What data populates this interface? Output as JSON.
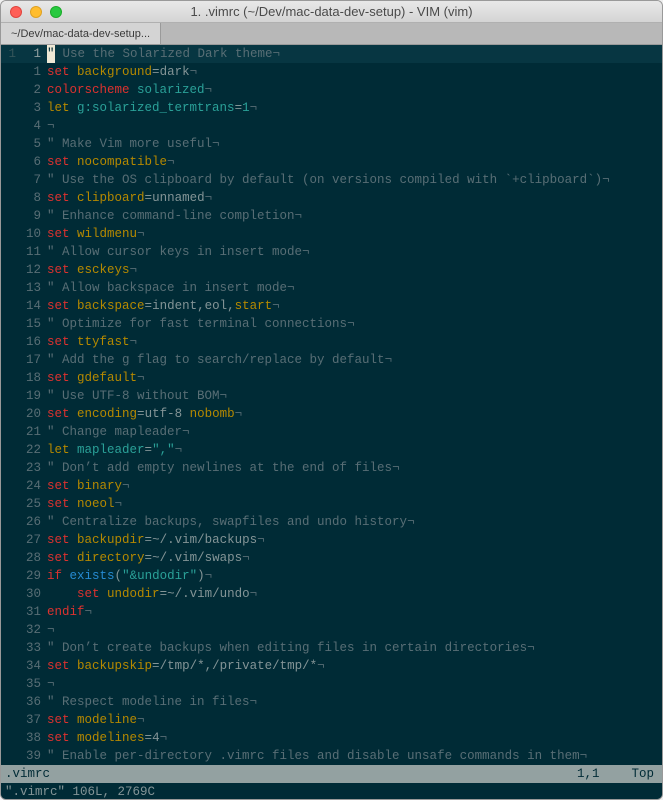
{
  "window": {
    "title": "1. .vimrc (~/Dev/mac-data-dev-setup) - VIM (vim)",
    "tab": "~/Dev/mac-data-dev-setup..."
  },
  "gutter_outer": "1",
  "lines": [
    {
      "n": "1",
      "tokens": [
        {
          "t": "\"",
          "c": "c-comment"
        },
        {
          "t": " Use the Solarized Dark theme",
          "c": "c-comment"
        },
        {
          "t": "¬",
          "c": "c-neg"
        }
      ],
      "cursor": true
    },
    {
      "n": "1",
      "tokens": [
        {
          "t": "set",
          "c": "c-set"
        },
        {
          "t": " "
        },
        {
          "t": "background",
          "c": "c-option"
        },
        {
          "t": "=",
          "c": "c-eq"
        },
        {
          "t": "dark",
          "c": "c-val"
        },
        {
          "t": "¬",
          "c": "c-neg"
        }
      ]
    },
    {
      "n": "2",
      "tokens": [
        {
          "t": "colorscheme",
          "c": "c-set"
        },
        {
          "t": " "
        },
        {
          "t": "solarized",
          "c": "c-cyan"
        },
        {
          "t": "¬",
          "c": "c-neg"
        }
      ]
    },
    {
      "n": "3",
      "tokens": [
        {
          "t": "let",
          "c": "c-let"
        },
        {
          "t": " "
        },
        {
          "t": "g:solarized_termtrans",
          "c": "c-cyan"
        },
        {
          "t": "=",
          "c": "c-eq"
        },
        {
          "t": "1",
          "c": "c-cyan"
        },
        {
          "t": "¬",
          "c": "c-neg"
        }
      ]
    },
    {
      "n": "4",
      "tokens": [
        {
          "t": "¬",
          "c": "c-neg"
        }
      ]
    },
    {
      "n": "5",
      "tokens": [
        {
          "t": "\" Make Vim more useful",
          "c": "c-comment"
        },
        {
          "t": "¬",
          "c": "c-neg"
        }
      ]
    },
    {
      "n": "6",
      "tokens": [
        {
          "t": "set",
          "c": "c-set"
        },
        {
          "t": " "
        },
        {
          "t": "nocompatible",
          "c": "c-option"
        },
        {
          "t": "¬",
          "c": "c-neg"
        }
      ]
    },
    {
      "n": "7",
      "tokens": [
        {
          "t": "\" Use the OS clipboard by default (on versions compiled with `+clipboard`)",
          "c": "c-comment"
        },
        {
          "t": "¬",
          "c": "c-neg"
        }
      ]
    },
    {
      "n": "8",
      "tokens": [
        {
          "t": "set",
          "c": "c-set"
        },
        {
          "t": " "
        },
        {
          "t": "clipboard",
          "c": "c-option"
        },
        {
          "t": "=",
          "c": "c-eq"
        },
        {
          "t": "unnamed",
          "c": "c-val"
        },
        {
          "t": "¬",
          "c": "c-neg"
        }
      ]
    },
    {
      "n": "9",
      "tokens": [
        {
          "t": "\" Enhance command-line completion",
          "c": "c-comment"
        },
        {
          "t": "¬",
          "c": "c-neg"
        }
      ]
    },
    {
      "n": "10",
      "tokens": [
        {
          "t": "set",
          "c": "c-set"
        },
        {
          "t": " "
        },
        {
          "t": "wildmenu",
          "c": "c-option"
        },
        {
          "t": "¬",
          "c": "c-neg"
        }
      ]
    },
    {
      "n": "11",
      "tokens": [
        {
          "t": "\" Allow cursor keys in insert mode",
          "c": "c-comment"
        },
        {
          "t": "¬",
          "c": "c-neg"
        }
      ]
    },
    {
      "n": "12",
      "tokens": [
        {
          "t": "set",
          "c": "c-set"
        },
        {
          "t": " "
        },
        {
          "t": "esckeys",
          "c": "c-option"
        },
        {
          "t": "¬",
          "c": "c-neg"
        }
      ]
    },
    {
      "n": "13",
      "tokens": [
        {
          "t": "\" Allow backspace in insert mode",
          "c": "c-comment"
        },
        {
          "t": "¬",
          "c": "c-neg"
        }
      ]
    },
    {
      "n": "14",
      "tokens": [
        {
          "t": "set",
          "c": "c-set"
        },
        {
          "t": " "
        },
        {
          "t": "backspace",
          "c": "c-option"
        },
        {
          "t": "=",
          "c": "c-eq"
        },
        {
          "t": "indent",
          "c": "c-val"
        },
        {
          "t": ",",
          "c": "c-eq"
        },
        {
          "t": "eol",
          "c": "c-val"
        },
        {
          "t": ",",
          "c": "c-eq"
        },
        {
          "t": "start",
          "c": "c-option"
        },
        {
          "t": "¬",
          "c": "c-neg"
        }
      ]
    },
    {
      "n": "15",
      "tokens": [
        {
          "t": "\" Optimize for fast terminal connections",
          "c": "c-comment"
        },
        {
          "t": "¬",
          "c": "c-neg"
        }
      ]
    },
    {
      "n": "16",
      "tokens": [
        {
          "t": "set",
          "c": "c-set"
        },
        {
          "t": " "
        },
        {
          "t": "ttyfast",
          "c": "c-option"
        },
        {
          "t": "¬",
          "c": "c-neg"
        }
      ]
    },
    {
      "n": "17",
      "tokens": [
        {
          "t": "\" Add the g flag to search/replace by default",
          "c": "c-comment"
        },
        {
          "t": "¬",
          "c": "c-neg"
        }
      ]
    },
    {
      "n": "18",
      "tokens": [
        {
          "t": "set",
          "c": "c-set"
        },
        {
          "t": " "
        },
        {
          "t": "gdefault",
          "c": "c-option"
        },
        {
          "t": "¬",
          "c": "c-neg"
        }
      ]
    },
    {
      "n": "19",
      "tokens": [
        {
          "t": "\" Use UTF-8 without BOM",
          "c": "c-comment"
        },
        {
          "t": "¬",
          "c": "c-neg"
        }
      ]
    },
    {
      "n": "20",
      "tokens": [
        {
          "t": "set",
          "c": "c-set"
        },
        {
          "t": " "
        },
        {
          "t": "encoding",
          "c": "c-option"
        },
        {
          "t": "=",
          "c": "c-eq"
        },
        {
          "t": "utf-8",
          "c": "c-val"
        },
        {
          "t": " "
        },
        {
          "t": "nobomb",
          "c": "c-option"
        },
        {
          "t": "¬",
          "c": "c-neg"
        }
      ]
    },
    {
      "n": "21",
      "tokens": [
        {
          "t": "\" Change mapleader",
          "c": "c-comment"
        },
        {
          "t": "¬",
          "c": "c-neg"
        }
      ]
    },
    {
      "n": "22",
      "tokens": [
        {
          "t": "let",
          "c": "c-let"
        },
        {
          "t": " "
        },
        {
          "t": "mapleader",
          "c": "c-cyan"
        },
        {
          "t": "=",
          "c": "c-eq"
        },
        {
          "t": "\",\"",
          "c": "c-str"
        },
        {
          "t": "¬",
          "c": "c-neg"
        }
      ]
    },
    {
      "n": "23",
      "tokens": [
        {
          "t": "\" Don’t add empty newlines at the end of files",
          "c": "c-comment"
        },
        {
          "t": "¬",
          "c": "c-neg"
        }
      ]
    },
    {
      "n": "24",
      "tokens": [
        {
          "t": "set",
          "c": "c-set"
        },
        {
          "t": " "
        },
        {
          "t": "binary",
          "c": "c-option"
        },
        {
          "t": "¬",
          "c": "c-neg"
        }
      ]
    },
    {
      "n": "25",
      "tokens": [
        {
          "t": "set",
          "c": "c-set"
        },
        {
          "t": " "
        },
        {
          "t": "noeol",
          "c": "c-option"
        },
        {
          "t": "¬",
          "c": "c-neg"
        }
      ]
    },
    {
      "n": "26",
      "tokens": [
        {
          "t": "\" Centralize backups, swapfiles and undo history",
          "c": "c-comment"
        },
        {
          "t": "¬",
          "c": "c-neg"
        }
      ]
    },
    {
      "n": "27",
      "tokens": [
        {
          "t": "set",
          "c": "c-set"
        },
        {
          "t": " "
        },
        {
          "t": "backupdir",
          "c": "c-option"
        },
        {
          "t": "=",
          "c": "c-eq"
        },
        {
          "t": "~/.vim/backups",
          "c": "c-val"
        },
        {
          "t": "¬",
          "c": "c-neg"
        }
      ]
    },
    {
      "n": "28",
      "tokens": [
        {
          "t": "set",
          "c": "c-set"
        },
        {
          "t": " "
        },
        {
          "t": "directory",
          "c": "c-option"
        },
        {
          "t": "=",
          "c": "c-eq"
        },
        {
          "t": "~/.vim/swaps",
          "c": "c-val"
        },
        {
          "t": "¬",
          "c": "c-neg"
        }
      ]
    },
    {
      "n": "29",
      "tokens": [
        {
          "t": "if",
          "c": "c-if"
        },
        {
          "t": " "
        },
        {
          "t": "exists",
          "c": "c-func"
        },
        {
          "t": "(",
          "c": "c-eq"
        },
        {
          "t": "\"&undodir\"",
          "c": "c-str"
        },
        {
          "t": ")",
          "c": "c-eq"
        },
        {
          "t": "¬",
          "c": "c-neg"
        }
      ]
    },
    {
      "n": "30",
      "tokens": [
        {
          "t": "    "
        },
        {
          "t": "set",
          "c": "c-set"
        },
        {
          "t": " "
        },
        {
          "t": "undodir",
          "c": "c-option"
        },
        {
          "t": "=",
          "c": "c-eq"
        },
        {
          "t": "~/.vim/undo",
          "c": "c-val"
        },
        {
          "t": "¬",
          "c": "c-neg"
        }
      ]
    },
    {
      "n": "31",
      "tokens": [
        {
          "t": "endif",
          "c": "c-endif"
        },
        {
          "t": "¬",
          "c": "c-neg"
        }
      ]
    },
    {
      "n": "32",
      "tokens": [
        {
          "t": "¬",
          "c": "c-neg"
        }
      ]
    },
    {
      "n": "33",
      "tokens": [
        {
          "t": "\" Don’t create backups when editing files in certain directories",
          "c": "c-comment"
        },
        {
          "t": "¬",
          "c": "c-neg"
        }
      ]
    },
    {
      "n": "34",
      "tokens": [
        {
          "t": "set",
          "c": "c-set"
        },
        {
          "t": " "
        },
        {
          "t": "backupskip",
          "c": "c-option"
        },
        {
          "t": "=",
          "c": "c-eq"
        },
        {
          "t": "/tmp/*,/private/tmp/*",
          "c": "c-val"
        },
        {
          "t": "¬",
          "c": "c-neg"
        }
      ]
    },
    {
      "n": "35",
      "tokens": [
        {
          "t": "¬",
          "c": "c-neg"
        }
      ]
    },
    {
      "n": "36",
      "tokens": [
        {
          "t": "\" Respect modeline in files",
          "c": "c-comment"
        },
        {
          "t": "¬",
          "c": "c-neg"
        }
      ]
    },
    {
      "n": "37",
      "tokens": [
        {
          "t": "set",
          "c": "c-set"
        },
        {
          "t": " "
        },
        {
          "t": "modeline",
          "c": "c-option"
        },
        {
          "t": "¬",
          "c": "c-neg"
        }
      ]
    },
    {
      "n": "38",
      "tokens": [
        {
          "t": "set",
          "c": "c-set"
        },
        {
          "t": " "
        },
        {
          "t": "modelines",
          "c": "c-option"
        },
        {
          "t": "=",
          "c": "c-eq"
        },
        {
          "t": "4",
          "c": "c-val"
        },
        {
          "t": "¬",
          "c": "c-neg"
        }
      ]
    },
    {
      "n": "39",
      "tokens": [
        {
          "t": "\" Enable per-directory .vimrc files and disable unsafe commands in them",
          "c": "c-comment"
        },
        {
          "t": "¬",
          "c": "c-neg"
        }
      ]
    }
  ],
  "status": {
    "filename": ".vimrc",
    "position": "1,1",
    "scroll": "Top"
  },
  "cmdline": "\".vimrc\" 106L, 2769C"
}
